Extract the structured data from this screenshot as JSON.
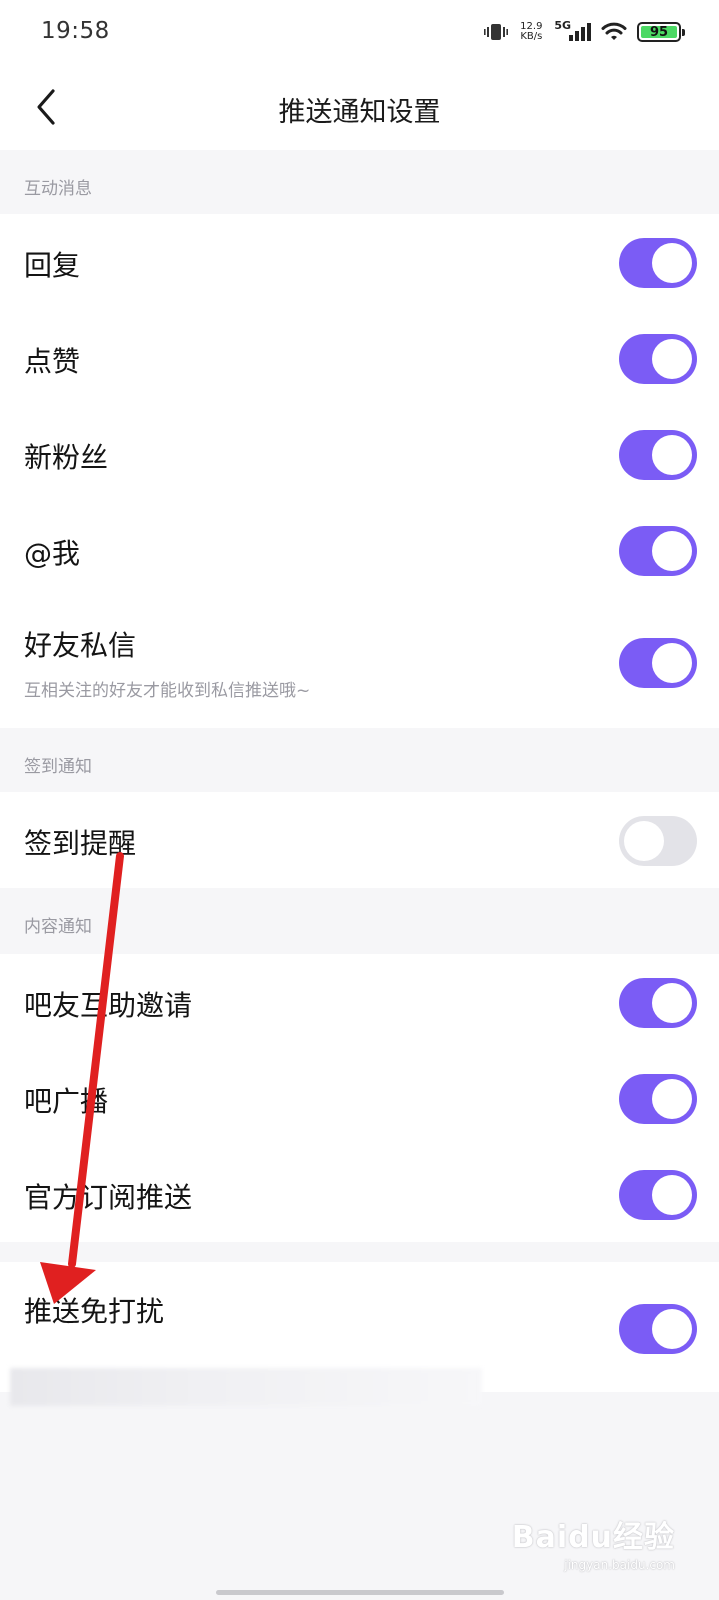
{
  "status_bar": {
    "time": "19:58",
    "net_speed_value": "12.9",
    "net_speed_unit": "KB/s",
    "signal_label": "5G",
    "battery": "95"
  },
  "nav": {
    "title": "推送通知设置"
  },
  "sections": {
    "interaction": {
      "header": "互动消息",
      "items": [
        {
          "label": "回复",
          "enabled": true
        },
        {
          "label": "点赞",
          "enabled": true
        },
        {
          "label": "新粉丝",
          "enabled": true
        },
        {
          "label": "@我",
          "enabled": true
        },
        {
          "label": "好友私信",
          "subtitle": "互相关注的好友才能收到私信推送哦~",
          "enabled": true
        }
      ]
    },
    "checkin": {
      "header": "签到通知",
      "items": [
        {
          "label": "签到提醒",
          "enabled": false
        }
      ]
    },
    "content": {
      "header": "内容通知",
      "items": [
        {
          "label": "吧友互助邀请",
          "enabled": true
        },
        {
          "label": "吧广播",
          "enabled": true
        },
        {
          "label": "官方订阅推送",
          "enabled": true
        }
      ]
    },
    "dnd": {
      "items": [
        {
          "label": "推送免打扰",
          "enabled": true
        }
      ]
    }
  },
  "watermark": {
    "logo": "Baidu经验",
    "url": "jingyan.baidu.com"
  },
  "colors": {
    "toggle_on": "#7b5cf5",
    "toggle_off": "#e3e3e8",
    "annotation_arrow": "#e02020",
    "page_bg": "#f6f6f8"
  }
}
